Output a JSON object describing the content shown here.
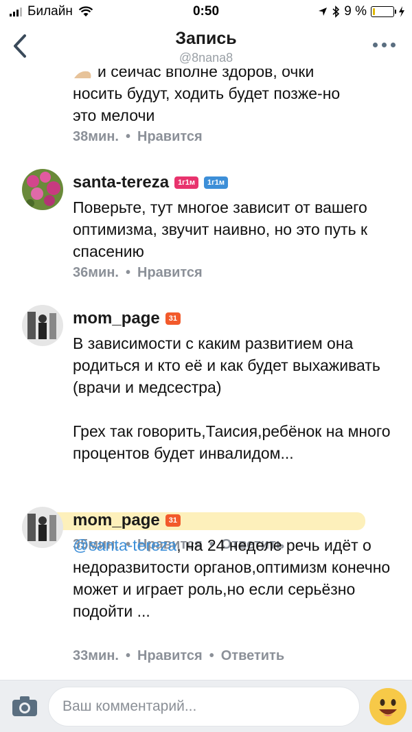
{
  "status_bar": {
    "carrier": "Билайн",
    "time": "0:50",
    "battery_text": "9 %",
    "battery_level": 0.09
  },
  "nav": {
    "title": "Запись",
    "subtitle": "@8nana8"
  },
  "comments": [
    {
      "text_lines": [
        "и сейчас вполне здоров, очки",
        "носить будут, ходить будет позже-но",
        "это мелочи"
      ],
      "time": "38мин.",
      "like": "Нравится"
    },
    {
      "author": "santa-tereza",
      "badges": [
        {
          "text": "1г1м",
          "color": "#e8336d"
        },
        {
          "text": "1г1м",
          "color": "#3d8fd8"
        }
      ],
      "text": "Поверьте, тут многое зависит от вашего оптимизма, звучит наивно, но это путь к спасению",
      "time": "36мин.",
      "like": "Нравится"
    },
    {
      "author": "mom_page",
      "badges": [
        {
          "text": "31",
          "color": "#f25a2b"
        }
      ],
      "text1": "В зависимости с каким развитием она родиться и кто её и как будет выхаживать (врачи и медсестра)",
      "text2": "Грех так говорить,Таисия,ребёнок на много процентов будет инвалидом...",
      "time": "35мин.",
      "like": "Нравится",
      "reply": "Ответить"
    },
    {
      "author": "mom_page",
      "badges": [
        {
          "text": "31",
          "color": "#f25a2b"
        }
      ],
      "mention": "@santa-tereza",
      "text": ", на 24 неделе речь идёт о недоразвитости органов,оптимизм конечно может и играет роль,но если серьёзно подойти ...",
      "time": "33мин.",
      "like": "Нравится",
      "reply": "Ответить"
    }
  ],
  "composer": {
    "placeholder": "Ваш комментарий..."
  },
  "colors": {
    "link": "#3d8fd8",
    "meta": "#8b9098",
    "highlight": "#fce278"
  },
  "icons": [
    "back-chevron-icon",
    "more-icon",
    "camera-icon",
    "emoji-icon",
    "wifi-icon",
    "bluetooth-icon",
    "location-icon",
    "charging-icon"
  ]
}
